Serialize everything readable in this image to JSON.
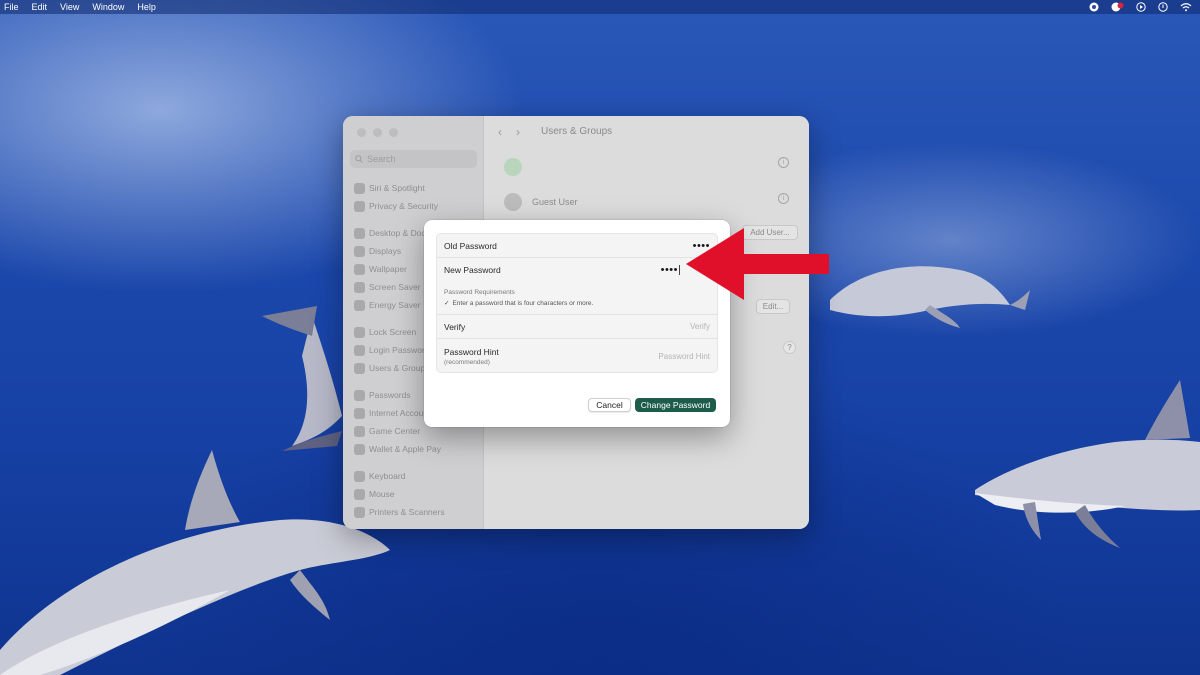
{
  "menubar": {
    "items": [
      "File",
      "Edit",
      "View",
      "Window",
      "Help"
    ],
    "status_icons": [
      "record-icon",
      "screen-record-icon",
      "play-icon",
      "power-icon",
      "wifi-icon"
    ]
  },
  "settings_window": {
    "search_placeholder": "Search",
    "sidebar_groups": [
      [
        "Siri & Spotlight",
        "Privacy & Security"
      ],
      [
        "Desktop & Dock",
        "Displays",
        "Wallpaper",
        "Screen Saver",
        "Energy Saver"
      ],
      [
        "Lock Screen",
        "Login Password",
        "Users & Groups"
      ],
      [
        "Passwords",
        "Internet Accounts",
        "Game Center",
        "Wallet & Apple Pay"
      ],
      [
        "Keyboard",
        "Mouse",
        "Printers & Scanners"
      ]
    ],
    "title": "Users & Groups",
    "guest_user": "Guest User",
    "add_user_label": "Add User...",
    "edit_label": "Edit...",
    "help_label": "?"
  },
  "dialog": {
    "old_password_label": "Old Password",
    "old_password_value": "••••",
    "new_password_label": "New Password",
    "new_password_value": "••••",
    "requirements_title": "Password Requirements",
    "requirement_check": "✓",
    "requirement_text": "Enter a password that is four characters or more.",
    "verify_label": "Verify",
    "verify_placeholder": "Verify",
    "hint_label": "Password Hint",
    "hint_sub": "(recommended)",
    "hint_placeholder": "Password Hint",
    "cancel_label": "Cancel",
    "change_label": "Change Password"
  },
  "colors": {
    "primary_button": "#1d5c4a",
    "annotation_arrow": "#e0102a",
    "wallpaper_blue": "#1c49ad"
  }
}
